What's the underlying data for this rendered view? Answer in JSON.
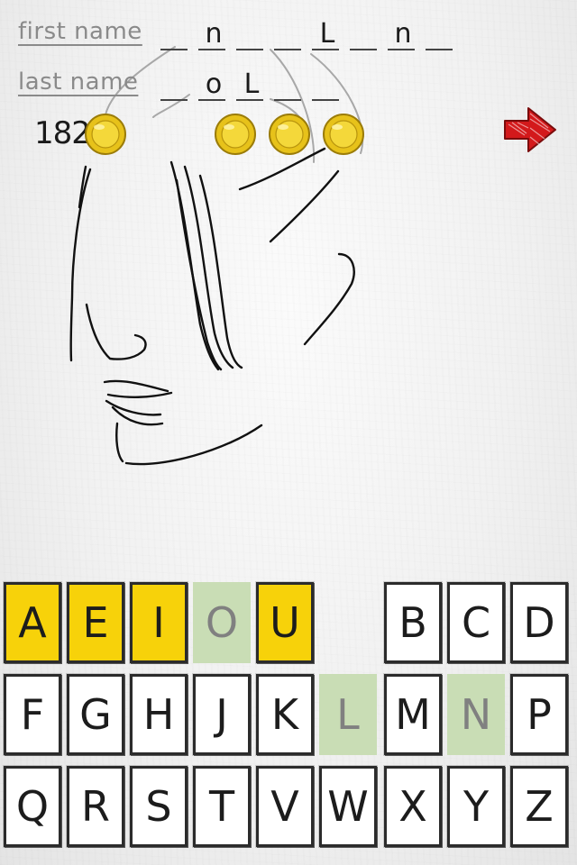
{
  "labels": {
    "first_name": "first name",
    "last_name": "last name"
  },
  "first_name_slots": [
    "",
    "n",
    "",
    "",
    "L",
    "",
    "n",
    ""
  ],
  "last_name_slots": [
    "",
    "o",
    "L",
    "",
    ""
  ],
  "coins": {
    "count": "182",
    "remaining_hint_coins": 4
  },
  "icons": {
    "next": "red-scribbled-arrow-icon",
    "coin": "gold-coin-icon"
  },
  "colors": {
    "vowel_key": "#f7d20a",
    "used_key": "#c9ddb5",
    "arrow": "#d3191b"
  },
  "keyboard": {
    "rows": [
      [
        {
          "letter": "A",
          "state": "vowel"
        },
        {
          "letter": "E",
          "state": "vowel"
        },
        {
          "letter": "I",
          "state": "vowel"
        },
        {
          "letter": "O",
          "state": "used"
        },
        {
          "letter": "U",
          "state": "vowel"
        },
        {
          "letter": "B",
          "state": "normal"
        },
        {
          "letter": "C",
          "state": "normal"
        },
        {
          "letter": "D",
          "state": "normal"
        }
      ],
      [
        {
          "letter": "F",
          "state": "normal"
        },
        {
          "letter": "G",
          "state": "normal"
        },
        {
          "letter": "H",
          "state": "normal"
        },
        {
          "letter": "J",
          "state": "normal"
        },
        {
          "letter": "K",
          "state": "normal"
        },
        {
          "letter": "L",
          "state": "used"
        },
        {
          "letter": "M",
          "state": "normal"
        },
        {
          "letter": "N",
          "state": "used"
        },
        {
          "letter": "P",
          "state": "normal"
        }
      ],
      [
        {
          "letter": "Q",
          "state": "normal"
        },
        {
          "letter": "R",
          "state": "normal"
        },
        {
          "letter": "S",
          "state": "normal"
        },
        {
          "letter": "T",
          "state": "normal"
        },
        {
          "letter": "V",
          "state": "normal"
        },
        {
          "letter": "W",
          "state": "normal"
        },
        {
          "letter": "X",
          "state": "normal"
        },
        {
          "letter": "Y",
          "state": "normal"
        },
        {
          "letter": "Z",
          "state": "normal"
        }
      ]
    ]
  }
}
